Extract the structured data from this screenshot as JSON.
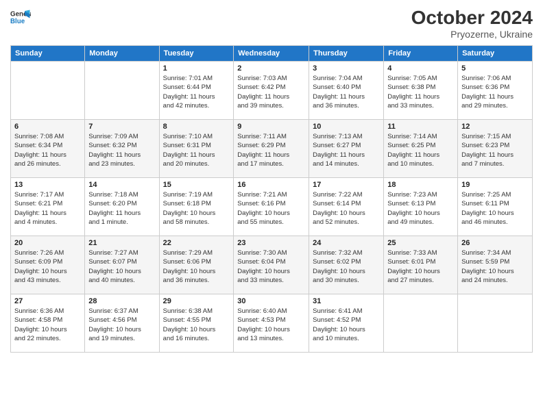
{
  "logo": {
    "line1": "General",
    "line2": "Blue"
  },
  "title": "October 2024",
  "subtitle": "Pryozerne, Ukraine",
  "days_header": [
    "Sunday",
    "Monday",
    "Tuesday",
    "Wednesday",
    "Thursday",
    "Friday",
    "Saturday"
  ],
  "weeks": [
    [
      {
        "day": "",
        "info": ""
      },
      {
        "day": "",
        "info": ""
      },
      {
        "day": "1",
        "info": "Sunrise: 7:01 AM\nSunset: 6:44 PM\nDaylight: 11 hours\nand 42 minutes."
      },
      {
        "day": "2",
        "info": "Sunrise: 7:03 AM\nSunset: 6:42 PM\nDaylight: 11 hours\nand 39 minutes."
      },
      {
        "day": "3",
        "info": "Sunrise: 7:04 AM\nSunset: 6:40 PM\nDaylight: 11 hours\nand 36 minutes."
      },
      {
        "day": "4",
        "info": "Sunrise: 7:05 AM\nSunset: 6:38 PM\nDaylight: 11 hours\nand 33 minutes."
      },
      {
        "day": "5",
        "info": "Sunrise: 7:06 AM\nSunset: 6:36 PM\nDaylight: 11 hours\nand 29 minutes."
      }
    ],
    [
      {
        "day": "6",
        "info": "Sunrise: 7:08 AM\nSunset: 6:34 PM\nDaylight: 11 hours\nand 26 minutes."
      },
      {
        "day": "7",
        "info": "Sunrise: 7:09 AM\nSunset: 6:32 PM\nDaylight: 11 hours\nand 23 minutes."
      },
      {
        "day": "8",
        "info": "Sunrise: 7:10 AM\nSunset: 6:31 PM\nDaylight: 11 hours\nand 20 minutes."
      },
      {
        "day": "9",
        "info": "Sunrise: 7:11 AM\nSunset: 6:29 PM\nDaylight: 11 hours\nand 17 minutes."
      },
      {
        "day": "10",
        "info": "Sunrise: 7:13 AM\nSunset: 6:27 PM\nDaylight: 11 hours\nand 14 minutes."
      },
      {
        "day": "11",
        "info": "Sunrise: 7:14 AM\nSunset: 6:25 PM\nDaylight: 11 hours\nand 10 minutes."
      },
      {
        "day": "12",
        "info": "Sunrise: 7:15 AM\nSunset: 6:23 PM\nDaylight: 11 hours\nand 7 minutes."
      }
    ],
    [
      {
        "day": "13",
        "info": "Sunrise: 7:17 AM\nSunset: 6:21 PM\nDaylight: 11 hours\nand 4 minutes."
      },
      {
        "day": "14",
        "info": "Sunrise: 7:18 AM\nSunset: 6:20 PM\nDaylight: 11 hours\nand 1 minute."
      },
      {
        "day": "15",
        "info": "Sunrise: 7:19 AM\nSunset: 6:18 PM\nDaylight: 10 hours\nand 58 minutes."
      },
      {
        "day": "16",
        "info": "Sunrise: 7:21 AM\nSunset: 6:16 PM\nDaylight: 10 hours\nand 55 minutes."
      },
      {
        "day": "17",
        "info": "Sunrise: 7:22 AM\nSunset: 6:14 PM\nDaylight: 10 hours\nand 52 minutes."
      },
      {
        "day": "18",
        "info": "Sunrise: 7:23 AM\nSunset: 6:13 PM\nDaylight: 10 hours\nand 49 minutes."
      },
      {
        "day": "19",
        "info": "Sunrise: 7:25 AM\nSunset: 6:11 PM\nDaylight: 10 hours\nand 46 minutes."
      }
    ],
    [
      {
        "day": "20",
        "info": "Sunrise: 7:26 AM\nSunset: 6:09 PM\nDaylight: 10 hours\nand 43 minutes."
      },
      {
        "day": "21",
        "info": "Sunrise: 7:27 AM\nSunset: 6:07 PM\nDaylight: 10 hours\nand 40 minutes."
      },
      {
        "day": "22",
        "info": "Sunrise: 7:29 AM\nSunset: 6:06 PM\nDaylight: 10 hours\nand 36 minutes."
      },
      {
        "day": "23",
        "info": "Sunrise: 7:30 AM\nSunset: 6:04 PM\nDaylight: 10 hours\nand 33 minutes."
      },
      {
        "day": "24",
        "info": "Sunrise: 7:32 AM\nSunset: 6:02 PM\nDaylight: 10 hours\nand 30 minutes."
      },
      {
        "day": "25",
        "info": "Sunrise: 7:33 AM\nSunset: 6:01 PM\nDaylight: 10 hours\nand 27 minutes."
      },
      {
        "day": "26",
        "info": "Sunrise: 7:34 AM\nSunset: 5:59 PM\nDaylight: 10 hours\nand 24 minutes."
      }
    ],
    [
      {
        "day": "27",
        "info": "Sunrise: 6:36 AM\nSunset: 4:58 PM\nDaylight: 10 hours\nand 22 minutes."
      },
      {
        "day": "28",
        "info": "Sunrise: 6:37 AM\nSunset: 4:56 PM\nDaylight: 10 hours\nand 19 minutes."
      },
      {
        "day": "29",
        "info": "Sunrise: 6:38 AM\nSunset: 4:55 PM\nDaylight: 10 hours\nand 16 minutes."
      },
      {
        "day": "30",
        "info": "Sunrise: 6:40 AM\nSunset: 4:53 PM\nDaylight: 10 hours\nand 13 minutes."
      },
      {
        "day": "31",
        "info": "Sunrise: 6:41 AM\nSunset: 4:52 PM\nDaylight: 10 hours\nand 10 minutes."
      },
      {
        "day": "",
        "info": ""
      },
      {
        "day": "",
        "info": ""
      }
    ]
  ]
}
